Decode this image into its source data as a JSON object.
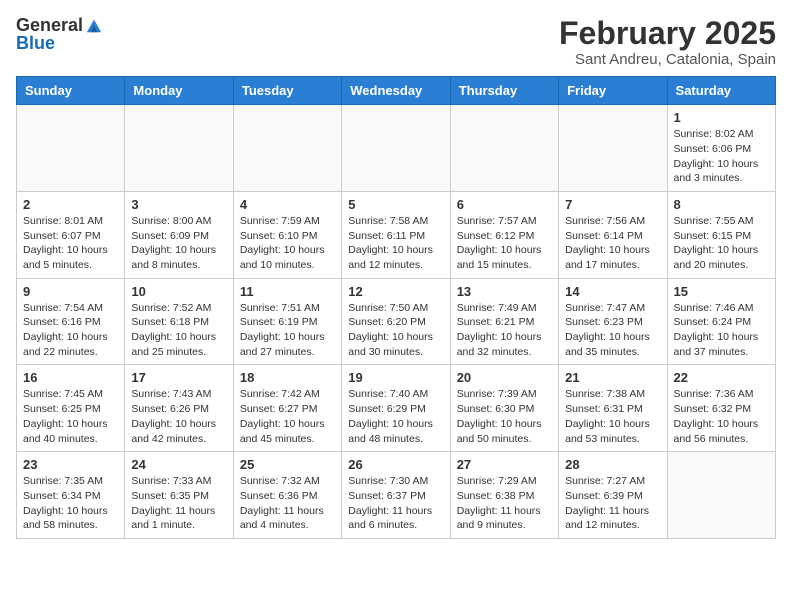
{
  "header": {
    "logo_general": "General",
    "logo_blue": "Blue",
    "title": "February 2025",
    "location": "Sant Andreu, Catalonia, Spain"
  },
  "weekdays": [
    "Sunday",
    "Monday",
    "Tuesday",
    "Wednesday",
    "Thursday",
    "Friday",
    "Saturday"
  ],
  "weeks": [
    [
      {
        "day": "",
        "info": ""
      },
      {
        "day": "",
        "info": ""
      },
      {
        "day": "",
        "info": ""
      },
      {
        "day": "",
        "info": ""
      },
      {
        "day": "",
        "info": ""
      },
      {
        "day": "",
        "info": ""
      },
      {
        "day": "1",
        "info": "Sunrise: 8:02 AM\nSunset: 6:06 PM\nDaylight: 10 hours and 3 minutes."
      }
    ],
    [
      {
        "day": "2",
        "info": "Sunrise: 8:01 AM\nSunset: 6:07 PM\nDaylight: 10 hours and 5 minutes."
      },
      {
        "day": "3",
        "info": "Sunrise: 8:00 AM\nSunset: 6:09 PM\nDaylight: 10 hours and 8 minutes."
      },
      {
        "day": "4",
        "info": "Sunrise: 7:59 AM\nSunset: 6:10 PM\nDaylight: 10 hours and 10 minutes."
      },
      {
        "day": "5",
        "info": "Sunrise: 7:58 AM\nSunset: 6:11 PM\nDaylight: 10 hours and 12 minutes."
      },
      {
        "day": "6",
        "info": "Sunrise: 7:57 AM\nSunset: 6:12 PM\nDaylight: 10 hours and 15 minutes."
      },
      {
        "day": "7",
        "info": "Sunrise: 7:56 AM\nSunset: 6:14 PM\nDaylight: 10 hours and 17 minutes."
      },
      {
        "day": "8",
        "info": "Sunrise: 7:55 AM\nSunset: 6:15 PM\nDaylight: 10 hours and 20 minutes."
      }
    ],
    [
      {
        "day": "9",
        "info": "Sunrise: 7:54 AM\nSunset: 6:16 PM\nDaylight: 10 hours and 22 minutes."
      },
      {
        "day": "10",
        "info": "Sunrise: 7:52 AM\nSunset: 6:18 PM\nDaylight: 10 hours and 25 minutes."
      },
      {
        "day": "11",
        "info": "Sunrise: 7:51 AM\nSunset: 6:19 PM\nDaylight: 10 hours and 27 minutes."
      },
      {
        "day": "12",
        "info": "Sunrise: 7:50 AM\nSunset: 6:20 PM\nDaylight: 10 hours and 30 minutes."
      },
      {
        "day": "13",
        "info": "Sunrise: 7:49 AM\nSunset: 6:21 PM\nDaylight: 10 hours and 32 minutes."
      },
      {
        "day": "14",
        "info": "Sunrise: 7:47 AM\nSunset: 6:23 PM\nDaylight: 10 hours and 35 minutes."
      },
      {
        "day": "15",
        "info": "Sunrise: 7:46 AM\nSunset: 6:24 PM\nDaylight: 10 hours and 37 minutes."
      }
    ],
    [
      {
        "day": "16",
        "info": "Sunrise: 7:45 AM\nSunset: 6:25 PM\nDaylight: 10 hours and 40 minutes."
      },
      {
        "day": "17",
        "info": "Sunrise: 7:43 AM\nSunset: 6:26 PM\nDaylight: 10 hours and 42 minutes."
      },
      {
        "day": "18",
        "info": "Sunrise: 7:42 AM\nSunset: 6:27 PM\nDaylight: 10 hours and 45 minutes."
      },
      {
        "day": "19",
        "info": "Sunrise: 7:40 AM\nSunset: 6:29 PM\nDaylight: 10 hours and 48 minutes."
      },
      {
        "day": "20",
        "info": "Sunrise: 7:39 AM\nSunset: 6:30 PM\nDaylight: 10 hours and 50 minutes."
      },
      {
        "day": "21",
        "info": "Sunrise: 7:38 AM\nSunset: 6:31 PM\nDaylight: 10 hours and 53 minutes."
      },
      {
        "day": "22",
        "info": "Sunrise: 7:36 AM\nSunset: 6:32 PM\nDaylight: 10 hours and 56 minutes."
      }
    ],
    [
      {
        "day": "23",
        "info": "Sunrise: 7:35 AM\nSunset: 6:34 PM\nDaylight: 10 hours and 58 minutes."
      },
      {
        "day": "24",
        "info": "Sunrise: 7:33 AM\nSunset: 6:35 PM\nDaylight: 11 hours and 1 minute."
      },
      {
        "day": "25",
        "info": "Sunrise: 7:32 AM\nSunset: 6:36 PM\nDaylight: 11 hours and 4 minutes."
      },
      {
        "day": "26",
        "info": "Sunrise: 7:30 AM\nSunset: 6:37 PM\nDaylight: 11 hours and 6 minutes."
      },
      {
        "day": "27",
        "info": "Sunrise: 7:29 AM\nSunset: 6:38 PM\nDaylight: 11 hours and 9 minutes."
      },
      {
        "day": "28",
        "info": "Sunrise: 7:27 AM\nSunset: 6:39 PM\nDaylight: 11 hours and 12 minutes."
      },
      {
        "day": "",
        "info": ""
      }
    ]
  ]
}
